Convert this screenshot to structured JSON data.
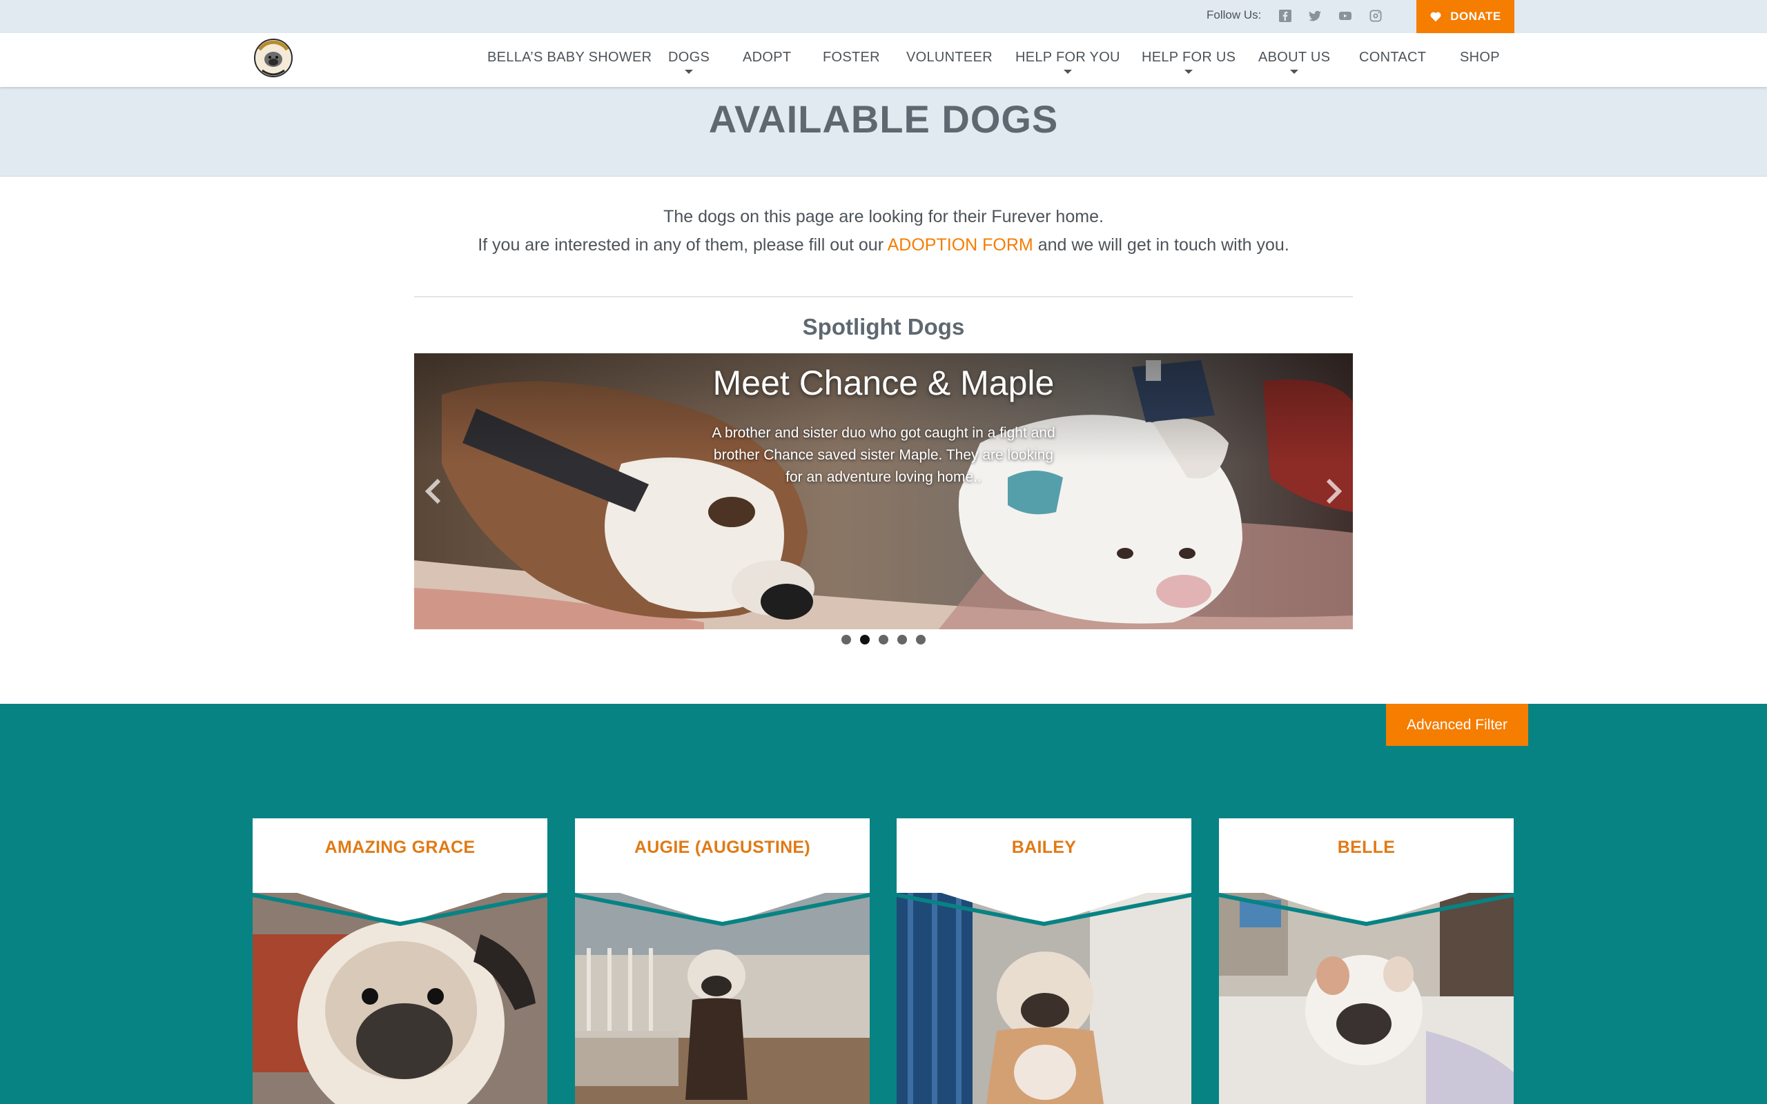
{
  "topbar": {
    "follow_label": "Follow Us:",
    "social_icons": [
      "facebook-icon",
      "twitter-icon",
      "youtube-icon",
      "instagram-icon"
    ],
    "donate_label": "DONATE"
  },
  "nav": {
    "items": [
      {
        "label": "BELLA’S BABY SHOWER",
        "dropdown": false
      },
      {
        "label": "DOGS",
        "dropdown": true
      },
      {
        "label": "ADOPT",
        "dropdown": false
      },
      {
        "label": "FOSTER",
        "dropdown": false
      },
      {
        "label": "VOLUNTEER",
        "dropdown": false
      },
      {
        "label": "HELP FOR YOU",
        "dropdown": true
      },
      {
        "label": "HELP FOR US",
        "dropdown": true
      },
      {
        "label": "ABOUT US",
        "dropdown": true
      },
      {
        "label": "CONTACT",
        "dropdown": false
      },
      {
        "label": "SHOP",
        "dropdown": false
      }
    ]
  },
  "page": {
    "title": "AVAILABLE DOGS",
    "intro_line1": "The dogs on this page are looking for their Furever home.",
    "intro_line2_before": "If you are interested in any of them, please fill out our",
    "intro_link": "ADOPTION FORM",
    "intro_line2_after": "and we will get in touch with you."
  },
  "spotlight": {
    "heading": "Spotlight Dogs",
    "slide_title": "Meet Chance & Maple",
    "slide_text": "A brother and sister duo who got caught in a fight and brother Chance saved sister Maple. They are looking for an adventure loving home..",
    "dot_count": 5,
    "active_dot": 2
  },
  "listing": {
    "filter_label": "Advanced Filter",
    "dogs": [
      {
        "name": "AMAZING GRACE"
      },
      {
        "name": "AUGIE (AUGUSTINE)"
      },
      {
        "name": "BAILEY"
      },
      {
        "name": "BELLE"
      }
    ]
  },
  "colors": {
    "accent_orange": "#f57d00",
    "teal": "#078384",
    "light_band": "#e1e9f1"
  }
}
